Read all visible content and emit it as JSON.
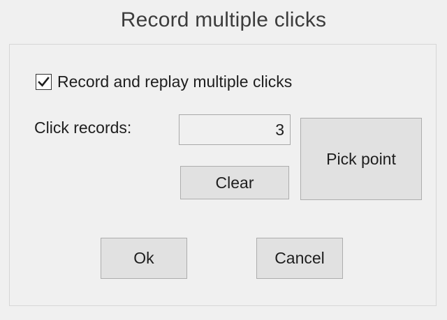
{
  "dialog": {
    "title": "Record multiple clicks"
  },
  "options": {
    "multi_click_checked": true,
    "multi_click_label": "Record and replay multiple clicks"
  },
  "records": {
    "label": "Click records:",
    "value": "3"
  },
  "buttons": {
    "clear": "Clear",
    "pick_point": "Pick point",
    "ok": "Ok",
    "cancel": "Cancel"
  },
  "icons": {
    "checkbox_check": "checkmark-icon"
  }
}
